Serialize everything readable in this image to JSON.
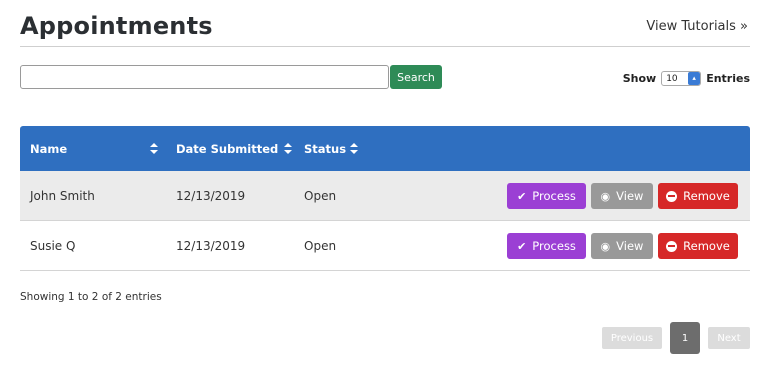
{
  "header": {
    "title": "Appointments",
    "tutorials_link": "View Tutorials »"
  },
  "search": {
    "value": "",
    "button_label": "Search"
  },
  "length": {
    "show_label": "Show",
    "selected": "10",
    "entries_label": "Entries"
  },
  "table": {
    "columns": [
      "Name",
      "Date Submitted",
      "Status"
    ],
    "rows": [
      {
        "name": "John Smith",
        "date": "12/13/2019",
        "status": "Open"
      },
      {
        "name": "Susie Q",
        "date": "12/13/2019",
        "status": "Open"
      }
    ],
    "actions": {
      "process": "Process",
      "view": "View",
      "remove": "Remove"
    }
  },
  "info": "Showing 1 to 2 of 2 entries",
  "pagination": {
    "previous": "Previous",
    "current": "1",
    "next": "Next"
  },
  "colors": {
    "header_bg": "#2f6fc0",
    "search_button": "#2e8b57",
    "process": "#9b3fd4",
    "view": "#999999",
    "remove": "#d62828"
  }
}
